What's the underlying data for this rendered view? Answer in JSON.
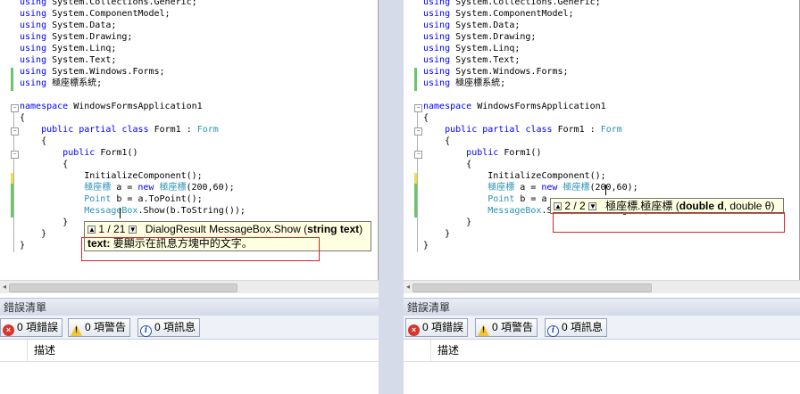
{
  "code_lines": [
    {
      "parts": [
        {
          "t": "using",
          "c": "kw"
        },
        {
          "t": " System.Collections.Generic;"
        }
      ]
    },
    {
      "parts": [
        {
          "t": "using",
          "c": "kw"
        },
        {
          "t": " System.ComponentModel;"
        }
      ]
    },
    {
      "parts": [
        {
          "t": "using",
          "c": "kw"
        },
        {
          "t": " System.Data;"
        }
      ]
    },
    {
      "parts": [
        {
          "t": "using",
          "c": "kw"
        },
        {
          "t": " System.Drawing;"
        }
      ]
    },
    {
      "parts": [
        {
          "t": "using",
          "c": "kw"
        },
        {
          "t": " System.Linq;"
        }
      ]
    },
    {
      "parts": [
        {
          "t": "using",
          "c": "kw"
        },
        {
          "t": " System.Text;"
        }
      ]
    },
    {
      "parts": [
        {
          "t": "using",
          "c": "kw"
        },
        {
          "t": " System.Windows.Forms;"
        }
      ]
    },
    {
      "parts": [
        {
          "t": "using",
          "c": "kw"
        },
        {
          "t": " 極座標系統;"
        }
      ]
    },
    {
      "parts": []
    },
    {
      "parts": [
        {
          "t": "namespace",
          "c": "kw"
        },
        {
          "t": " WindowsFormsApplication1"
        }
      ]
    },
    {
      "parts": [
        {
          "t": "{"
        }
      ]
    },
    {
      "parts": [
        {
          "t": "    "
        },
        {
          "t": "public",
          "c": "kw"
        },
        {
          "t": " "
        },
        {
          "t": "partial",
          "c": "kw"
        },
        {
          "t": " "
        },
        {
          "t": "class",
          "c": "kw"
        },
        {
          "t": " Form1 : "
        },
        {
          "t": "Form",
          "c": "ty"
        }
      ]
    },
    {
      "parts": [
        {
          "t": "    {"
        }
      ]
    },
    {
      "parts": [
        {
          "t": "        "
        },
        {
          "t": "public",
          "c": "kw"
        },
        {
          "t": " Form1()"
        }
      ]
    },
    {
      "parts": [
        {
          "t": "        {"
        }
      ]
    },
    {
      "parts": [
        {
          "t": "            InitializeComponent();"
        }
      ]
    },
    {
      "parts": [
        {
          "t": "            "
        },
        {
          "t": "極座標",
          "c": "ty"
        },
        {
          "t": " a = "
        },
        {
          "t": "new",
          "c": "kw"
        },
        {
          "t": " "
        },
        {
          "t": "極座標",
          "c": "ty"
        },
        {
          "t": "(200,60);"
        }
      ]
    },
    {
      "parts": [
        {
          "t": "            "
        },
        {
          "t": "Point",
          "c": "ty"
        },
        {
          "t": " b = a.ToPoint();"
        }
      ]
    },
    {
      "parts": [
        {
          "t": "            "
        },
        {
          "t": "MessageBox",
          "c": "ty"
        },
        {
          "t": ".Show(b.ToString());"
        }
      ]
    },
    {
      "parts": [
        {
          "t": "        }"
        }
      ]
    },
    {
      "parts": [
        {
          "t": "    }"
        }
      ]
    },
    {
      "parts": [
        {
          "t": "}"
        }
      ]
    }
  ],
  "code_lines_right": [
    {
      "parts": [
        {
          "t": "using",
          "c": "kw"
        },
        {
          "t": " System.Collections.Generic;"
        }
      ]
    },
    {
      "parts": [
        {
          "t": "using",
          "c": "kw"
        },
        {
          "t": " System.ComponentModel;"
        }
      ]
    },
    {
      "parts": [
        {
          "t": "using",
          "c": "kw"
        },
        {
          "t": " System.Data;"
        }
      ]
    },
    {
      "parts": [
        {
          "t": "using",
          "c": "kw"
        },
        {
          "t": " System.Drawing;"
        }
      ]
    },
    {
      "parts": [
        {
          "t": "using",
          "c": "kw"
        },
        {
          "t": " System.Linq;"
        }
      ]
    },
    {
      "parts": [
        {
          "t": "using",
          "c": "kw"
        },
        {
          "t": " System.Text;"
        }
      ]
    },
    {
      "parts": [
        {
          "t": "using",
          "c": "kw"
        },
        {
          "t": " System.Windows.Forms;"
        }
      ]
    },
    {
      "parts": [
        {
          "t": "using",
          "c": "kw"
        },
        {
          "t": " 極座標系統;"
        }
      ]
    },
    {
      "parts": []
    },
    {
      "parts": [
        {
          "t": "namespace",
          "c": "kw"
        },
        {
          "t": " WindowsFormsApplication1"
        }
      ]
    },
    {
      "parts": [
        {
          "t": "{"
        }
      ]
    },
    {
      "parts": [
        {
          "t": "    "
        },
        {
          "t": "public",
          "c": "kw"
        },
        {
          "t": " "
        },
        {
          "t": "partial",
          "c": "kw"
        },
        {
          "t": " "
        },
        {
          "t": "class",
          "c": "kw"
        },
        {
          "t": " Form1 : "
        },
        {
          "t": "Form",
          "c": "ty"
        }
      ]
    },
    {
      "parts": [
        {
          "t": "    {"
        }
      ]
    },
    {
      "parts": [
        {
          "t": "        "
        },
        {
          "t": "public",
          "c": "kw"
        },
        {
          "t": " Form1()"
        }
      ]
    },
    {
      "parts": [
        {
          "t": "        {"
        }
      ]
    },
    {
      "parts": [
        {
          "t": "            InitializeComponent();"
        }
      ]
    },
    {
      "parts": [
        {
          "t": "            "
        },
        {
          "t": "極座標",
          "c": "ty"
        },
        {
          "t": " a = "
        },
        {
          "t": "new",
          "c": "kw"
        },
        {
          "t": " "
        },
        {
          "t": "極座標",
          "c": "ty"
        },
        {
          "t": "(200,60);"
        }
      ]
    },
    {
      "parts": [
        {
          "t": "            "
        },
        {
          "t": "Point",
          "c": "ty"
        },
        {
          "t": " b = a"
        }
      ]
    },
    {
      "parts": [
        {
          "t": "            "
        },
        {
          "t": "MessageBox",
          "c": "ty"
        },
        {
          "t": ".Show(b.ToString());"
        }
      ]
    },
    {
      "parts": [
        {
          "t": "        }"
        }
      ]
    },
    {
      "parts": [
        {
          "t": "    }"
        }
      ]
    },
    {
      "parts": [
        {
          "t": "}"
        }
      ]
    }
  ],
  "left_tooltip": {
    "counter": "1 / 21",
    "signature_prefix": "DialogResult MessageBox.Show (",
    "signature_param": "string text",
    "signature_suffix": ")",
    "param_name": "text:",
    "param_desc": "要顯示在訊息方塊中的文字。"
  },
  "right_tooltip": {
    "counter": "2 / 2",
    "signature_prefix": "極座標.極座標 (",
    "signature_param": "double d",
    "signature_suffix": ", double θ)"
  },
  "error_list": {
    "title": "錯誤清單",
    "errors": "0 項錯誤",
    "warnings": "0 項警告",
    "messages": "0 項訊息",
    "column_description": "描述"
  }
}
